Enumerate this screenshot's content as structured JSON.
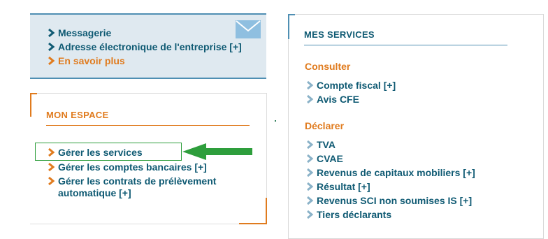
{
  "messaging": {
    "items": [
      {
        "label": "Messagerie",
        "color": "#0f5a73"
      },
      {
        "label": "Adresse électronique de l'entreprise [+]",
        "color": "#0f5a73"
      },
      {
        "label": "En savoir plus",
        "color": "#e07b1e"
      }
    ],
    "icon": "envelope-icon"
  },
  "mon_espace": {
    "title": "MON ESPACE",
    "items": [
      {
        "label": "Gérer les services"
      },
      {
        "label": "Gérer les comptes bancaires [+]"
      },
      {
        "label": "Gérer les contrats de prélèvement"
      },
      {
        "label": "automatique [+]"
      }
    ],
    "highlight_color": "#2e9e3c"
  },
  "mes_services": {
    "title": "MES SERVICES",
    "consulter": {
      "heading": "Consulter",
      "items": [
        "Compte fiscal [+]",
        "Avis CFE"
      ]
    },
    "declarer": {
      "heading": "Déclarer",
      "items": [
        "TVA",
        "CVAE",
        "Revenus de capitaux mobiliers [+]",
        "Résultat [+]",
        "Revenus SCI non soumises IS [+]",
        "Tiers déclarants"
      ]
    }
  },
  "colors": {
    "blue": "#0f5a73",
    "orange": "#e07b1e",
    "light_blue_bg": "#dfe9f0",
    "accent_blue": "#4f8fb3",
    "green": "#2e9e3c"
  }
}
